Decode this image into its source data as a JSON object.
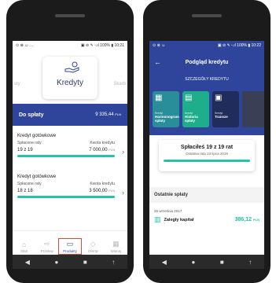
{
  "left_phone": {
    "status": {
      "left": "⊙ ⊗ ☺ …",
      "right": "▣ ⊘ ✎ ▫.ıl 100% ▮ 10:21"
    },
    "carousel": {
      "prev_label": "sty",
      "title": "Kredyty",
      "next_label": "Skarb"
    },
    "due_banner": {
      "label": "Do spłaty",
      "amount": "9 335,44",
      "currency": "PLN"
    },
    "loans": [
      {
        "name": "Kredyt gotówkowe",
        "paid_label": "Spłacone raty",
        "paid_value": "19 z 19",
        "amount_label": "Kwota kredytu",
        "amount_value": "7 000,00",
        "currency": "PLN"
      },
      {
        "name": "Kredyt gotówkowe",
        "paid_label": "Spłacone raty",
        "paid_value": "18 z 18",
        "amount_label": "Kwota kredytu",
        "amount_value": "3 500,00",
        "currency": "PLN"
      }
    ],
    "tabs": [
      {
        "label": "Start",
        "icon": "⌂"
      },
      {
        "label": "Przelew",
        "icon": "⇨"
      },
      {
        "label": "Produkty",
        "icon": "▭"
      },
      {
        "label": "Oferta",
        "icon": "◇"
      },
      {
        "label": "Więcej",
        "icon": "▦"
      }
    ],
    "nav": {
      "back": "◀",
      "home": "●",
      "recent": "■",
      "extra": "↑"
    }
  },
  "right_phone": {
    "status": {
      "left": "⊙ ⊗ ☺",
      "right": "▣ ⊘ ✎ ▫.ıl 100% ▮ 10:22"
    },
    "header": {
      "title": "Podgląd kredytu",
      "back": "←"
    },
    "details_label": "SZCZEGÓŁY KREDYTU",
    "cards": [
      {
        "kicker": "Kredyt",
        "label": "Harmonogram spłaty",
        "icon": "▦",
        "color": "#2a8d9a"
      },
      {
        "kicker": "Kredyt",
        "label": "Historia spłaty",
        "icon": "▤",
        "color": "#1fae8c"
      },
      {
        "kicker": "Kredyt",
        "label": "Transze",
        "icon": "▣",
        "color": "#1f2c5c"
      },
      {
        "kicker": "",
        "label": "",
        "icon": "",
        "color": "#3a3f55"
      }
    ],
    "paid_box": {
      "title": "Spłaciłeś 19 z 19 rat",
      "subtitle": "Ostatnia rata 23 lipca 2019"
    },
    "last_header": "Ostatnie spłaty",
    "last_date": "26 września 2017",
    "last_entry": {
      "name": "Zaległy kapitał",
      "value": "386,12",
      "currency": "PLN"
    },
    "nav": {
      "back": "◀",
      "home": "●",
      "recent": "■",
      "extra": "↑"
    }
  },
  "colors": {
    "brand_blue": "#2f449b",
    "accent_green": "#22c3a6",
    "highlight_red": "#e0473a"
  }
}
